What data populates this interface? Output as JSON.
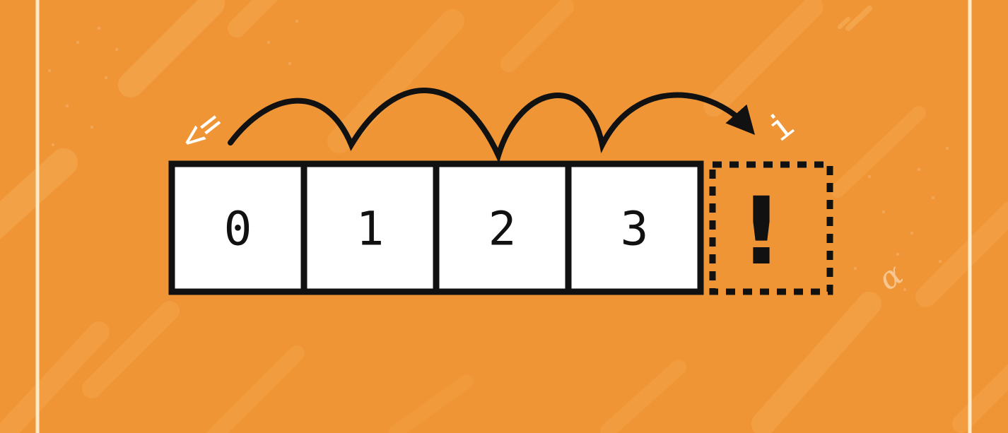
{
  "colors": {
    "background": "#f09535",
    "streak": "#f5ab55",
    "frame_line": "#ffe9c6",
    "cell_fill": "#ffffff",
    "stroke": "#111111",
    "glyph": "#ffffff"
  },
  "array_cells": [
    {
      "index_label": "0"
    },
    {
      "index_label": "1"
    },
    {
      "index_label": "2"
    },
    {
      "index_label": "3"
    }
  ],
  "out_of_bounds_cell": {
    "label": "!"
  },
  "left_marker": {
    "glyph": "<="
  },
  "right_marker": {
    "glyph": "i"
  },
  "decor": {
    "alpha_glyph": "α"
  },
  "icons": {
    "loop_arrow": "curved-hop-arrow-icon",
    "start_marker": "less-than-or-equal-icon",
    "end_marker": "letter-i-icon"
  }
}
